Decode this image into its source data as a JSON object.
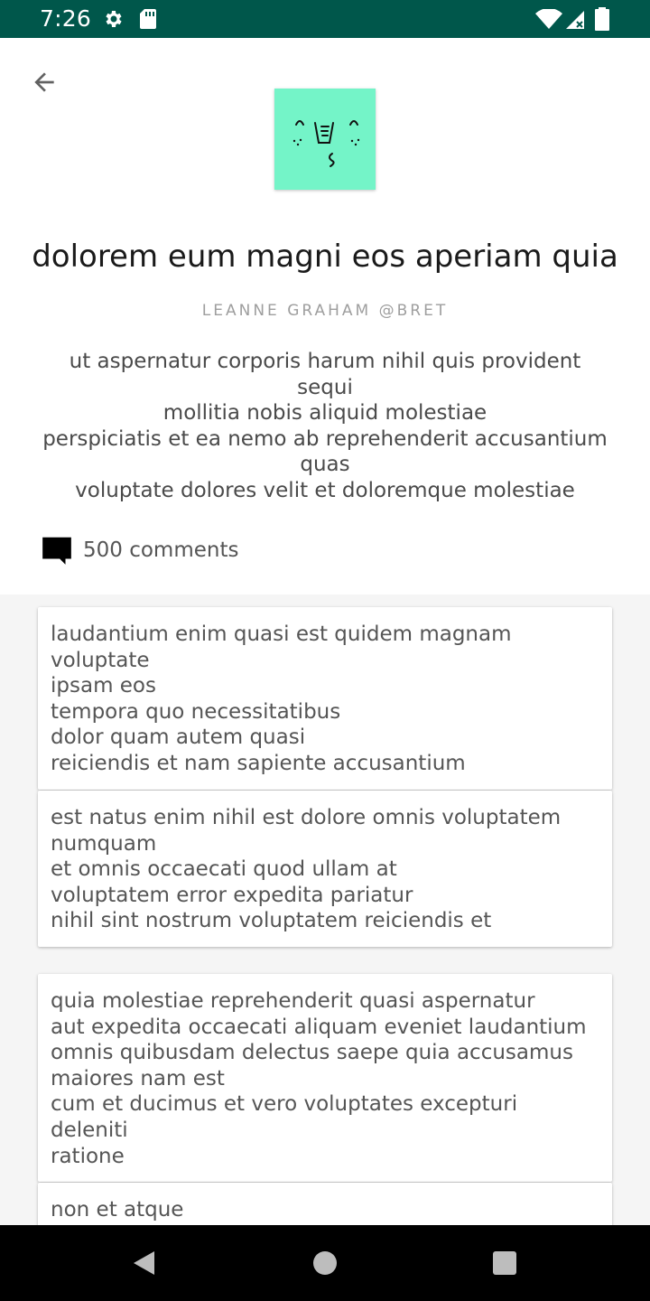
{
  "status_bar": {
    "time": "7:26",
    "icons": [
      "settings-icon",
      "sd-card-icon",
      "wifi-icon",
      "cell-signal-icon",
      "battery-icon"
    ],
    "background": "#00574b"
  },
  "header": {
    "back_icon": "arrow-back-icon",
    "avatar_color": "#74f4c8",
    "title": "dolorem eum magni eos aperiam quia",
    "author": "LEANNE GRAHAM @BRET",
    "body_lines": [
      "ut aspernatur corporis harum nihil quis provident",
      "sequi",
      "mollitia nobis aliquid molestiae",
      "perspiciatis et ea nemo ab reprehenderit accusantium",
      "quas",
      "voluptate dolores velit et doloremque molestiae"
    ],
    "comments_icon": "comment-icon",
    "comments_label": "500 comments"
  },
  "comments": [
    {
      "lines": [
        "laudantium enim quasi est quidem magnam voluptate",
        "ipsam eos",
        "tempora quo necessitatibus",
        "dolor quam autem quasi",
        "reiciendis et nam sapiente accusantium"
      ]
    },
    {
      "lines": [
        "est natus enim nihil est dolore omnis voluptatem",
        "numquam",
        "et omnis occaecati quod ullam at",
        "voluptatem error expedita pariatur",
        "nihil sint nostrum voluptatem reiciendis et"
      ]
    },
    {
      "lines": [
        "quia molestiae reprehenderit quasi aspernatur",
        "aut expedita occaecati aliquam eveniet laudantium",
        "omnis quibusdam delectus saepe quia accusamus",
        "maiores nam est",
        "cum et ducimus et vero voluptates excepturi deleniti",
        "ratione"
      ]
    },
    {
      "lines": [
        "non et atque"
      ]
    }
  ],
  "nav_bar": {
    "buttons": [
      "back-triangle-icon",
      "home-circle-icon",
      "recents-square-icon"
    ]
  }
}
